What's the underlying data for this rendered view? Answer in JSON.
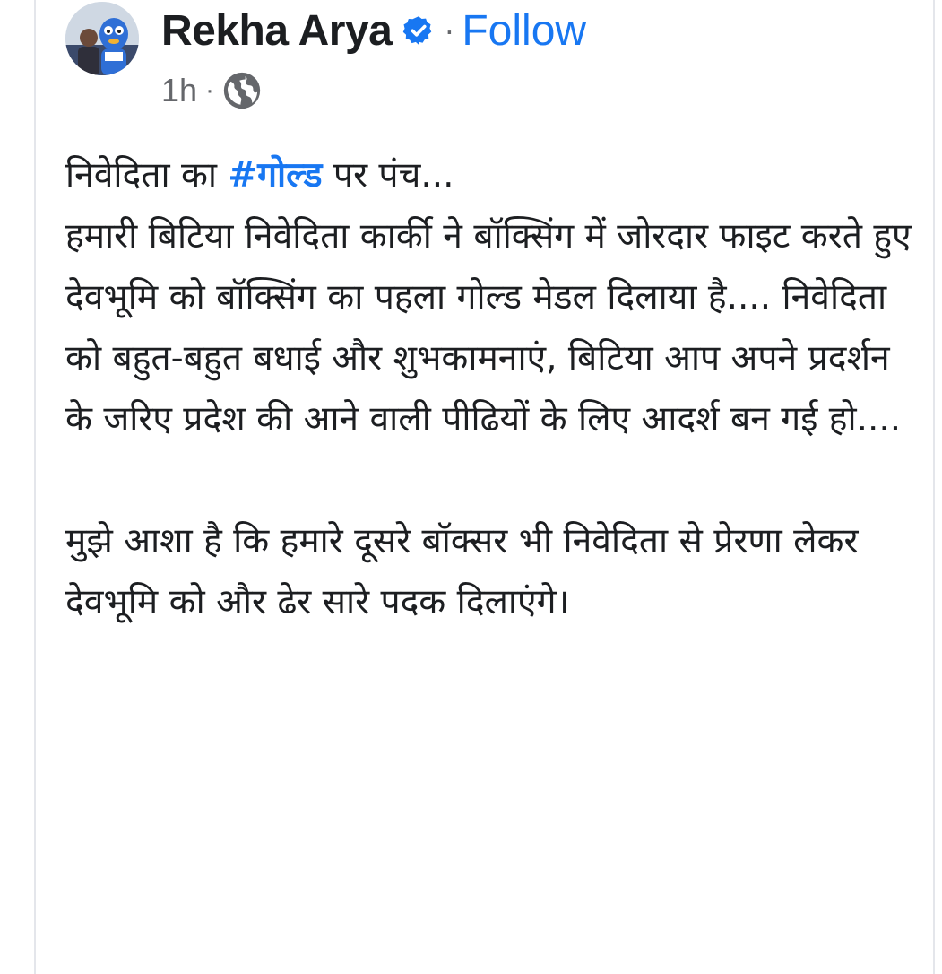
{
  "post": {
    "author": {
      "name": "Rekha Arya",
      "verified_icon": "verified-badge-icon",
      "avatar_icon": "profile-photo"
    },
    "follow_label": "Follow",
    "separator": "·",
    "timestamp": "1h",
    "audience_icon": "globe-icon",
    "body": {
      "line1_prefix": "निवेदिता का ",
      "hashtag": "#गोल्ड",
      "line1_suffix": " पर पंच...",
      "paragraph1": "हमारी बिटिया निवेदिता कार्की ने बॉक्सिंग में जोरदार फाइट करते हुए देवभूमि को बॉक्सिंग का पहला गोल्ड मेडल दिलाया है.... निवेदिता को बहुत-बहुत बधाई और शुभकामनाएं, बिटिया आप अपने प्रदर्शन के जरिए प्रदेश की आने वाली पीढियों के लिए आदर्श बन गई हो....",
      "paragraph2": "मुझे आशा है कि हमारे दूसरे बॉक्सर भी निवेदिता से प्रेरणा लेकर देवभूमि को और ढेर सारे पदक दिलाएंगे।"
    },
    "colors": {
      "link_blue": "#1877f2",
      "secondary_text": "#65676b",
      "primary_text": "#1c1e21"
    }
  }
}
